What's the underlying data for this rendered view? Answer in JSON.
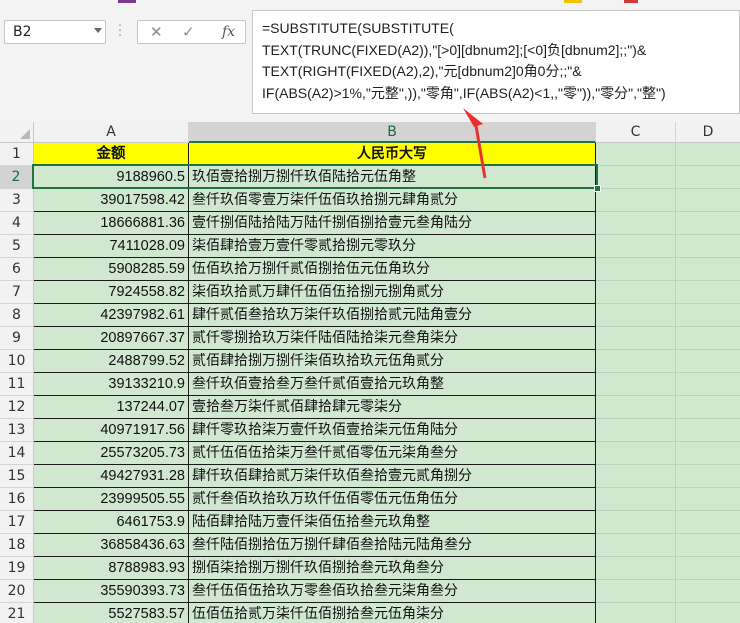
{
  "name_box": {
    "value": "B2"
  },
  "formula_bar": {
    "cancel_icon": "✕",
    "enter_icon": "✓",
    "fx_label": "fx",
    "lines": [
      "=SUBSTITUTE(SUBSTITUTE(",
      "TEXT(TRUNC(FIXED(A2)),\"[>0][dbnum2];[<0]负[dbnum2];;\")&",
      "TEXT(RIGHT(FIXED(A2),2),\"元[dbnum2]0角0分;;\"&",
      "IF(ABS(A2)>1%,\"元整\",)),\"零角\",IF(ABS(A2)<1,,\"零\")),\"零分\",\"整\")"
    ]
  },
  "columns": [
    "A",
    "B",
    "C",
    "D"
  ],
  "colors": {
    "header_fill": "#ffff00",
    "cell_fill": "#d0e8d0",
    "selection": "#217346",
    "arrow": "#e8312f"
  },
  "table": {
    "headers": [
      "金额",
      "人民币大写"
    ],
    "rows": [
      {
        "n": "2",
        "a": "9188960.5",
        "b": "玖佰壹拾捌万捌仟玖佰陆拾元伍角整"
      },
      {
        "n": "3",
        "a": "39017598.42",
        "b": "叁仟玖佰零壹万柒仟伍佰玖拾捌元肆角贰分"
      },
      {
        "n": "4",
        "a": "18666881.36",
        "b": "壹仟捌佰陆拾陆万陆仟捌佰捌拾壹元叁角陆分"
      },
      {
        "n": "5",
        "a": "7411028.09",
        "b": "柒佰肆拾壹万壹仟零贰拾捌元零玖分"
      },
      {
        "n": "6",
        "a": "5908285.59",
        "b": "伍佰玖拾万捌仟贰佰捌拾伍元伍角玖分"
      },
      {
        "n": "7",
        "a": "7924558.82",
        "b": "柒佰玖拾贰万肆仟伍佰伍拾捌元捌角贰分"
      },
      {
        "n": "8",
        "a": "42397982.61",
        "b": "肆仟贰佰叁拾玖万柒仟玖佰捌拾贰元陆角壹分"
      },
      {
        "n": "9",
        "a": "20897667.37",
        "b": "贰仟零捌拾玖万柒仟陆佰陆拾柒元叁角柒分"
      },
      {
        "n": "10",
        "a": "2488799.52",
        "b": "贰佰肆拾捌万捌仟柒佰玖拾玖元伍角贰分"
      },
      {
        "n": "11",
        "a": "39133210.9",
        "b": "叁仟玖佰壹拾叁万叁仟贰佰壹拾元玖角整"
      },
      {
        "n": "12",
        "a": "137244.07",
        "b": "壹拾叁万柒仟贰佰肆拾肆元零柒分"
      },
      {
        "n": "13",
        "a": "40971917.56",
        "b": "肆仟零玖拾柒万壹仟玖佰壹拾柒元伍角陆分"
      },
      {
        "n": "14",
        "a": "25573205.73",
        "b": "贰仟伍佰伍拾柒万叁仟贰佰零伍元柒角叁分"
      },
      {
        "n": "15",
        "a": "49427931.28",
        "b": "肆仟玖佰肆拾贰万柒仟玖佰叁拾壹元贰角捌分"
      },
      {
        "n": "16",
        "a": "23999505.55",
        "b": "贰仟叁佰玖拾玖万玖仟伍佰零伍元伍角伍分"
      },
      {
        "n": "17",
        "a": "6461753.9",
        "b": "陆佰肆拾陆万壹仟柒佰伍拾叁元玖角整"
      },
      {
        "n": "18",
        "a": "36858436.63",
        "b": "叁仟陆佰捌拾伍万捌仟肆佰叁拾陆元陆角叁分"
      },
      {
        "n": "19",
        "a": "8788983.93",
        "b": "捌佰柒拾捌万捌仟玖佰捌拾叁元玖角叁分"
      },
      {
        "n": "20",
        "a": "35590393.73",
        "b": "叁仟伍佰伍拾玖万零叁佰玖拾叁元柒角叁分"
      },
      {
        "n": "21",
        "a": "5527583.57",
        "b": "伍佰伍拾贰万柒仟伍佰捌拾叁元伍角柒分"
      }
    ]
  }
}
